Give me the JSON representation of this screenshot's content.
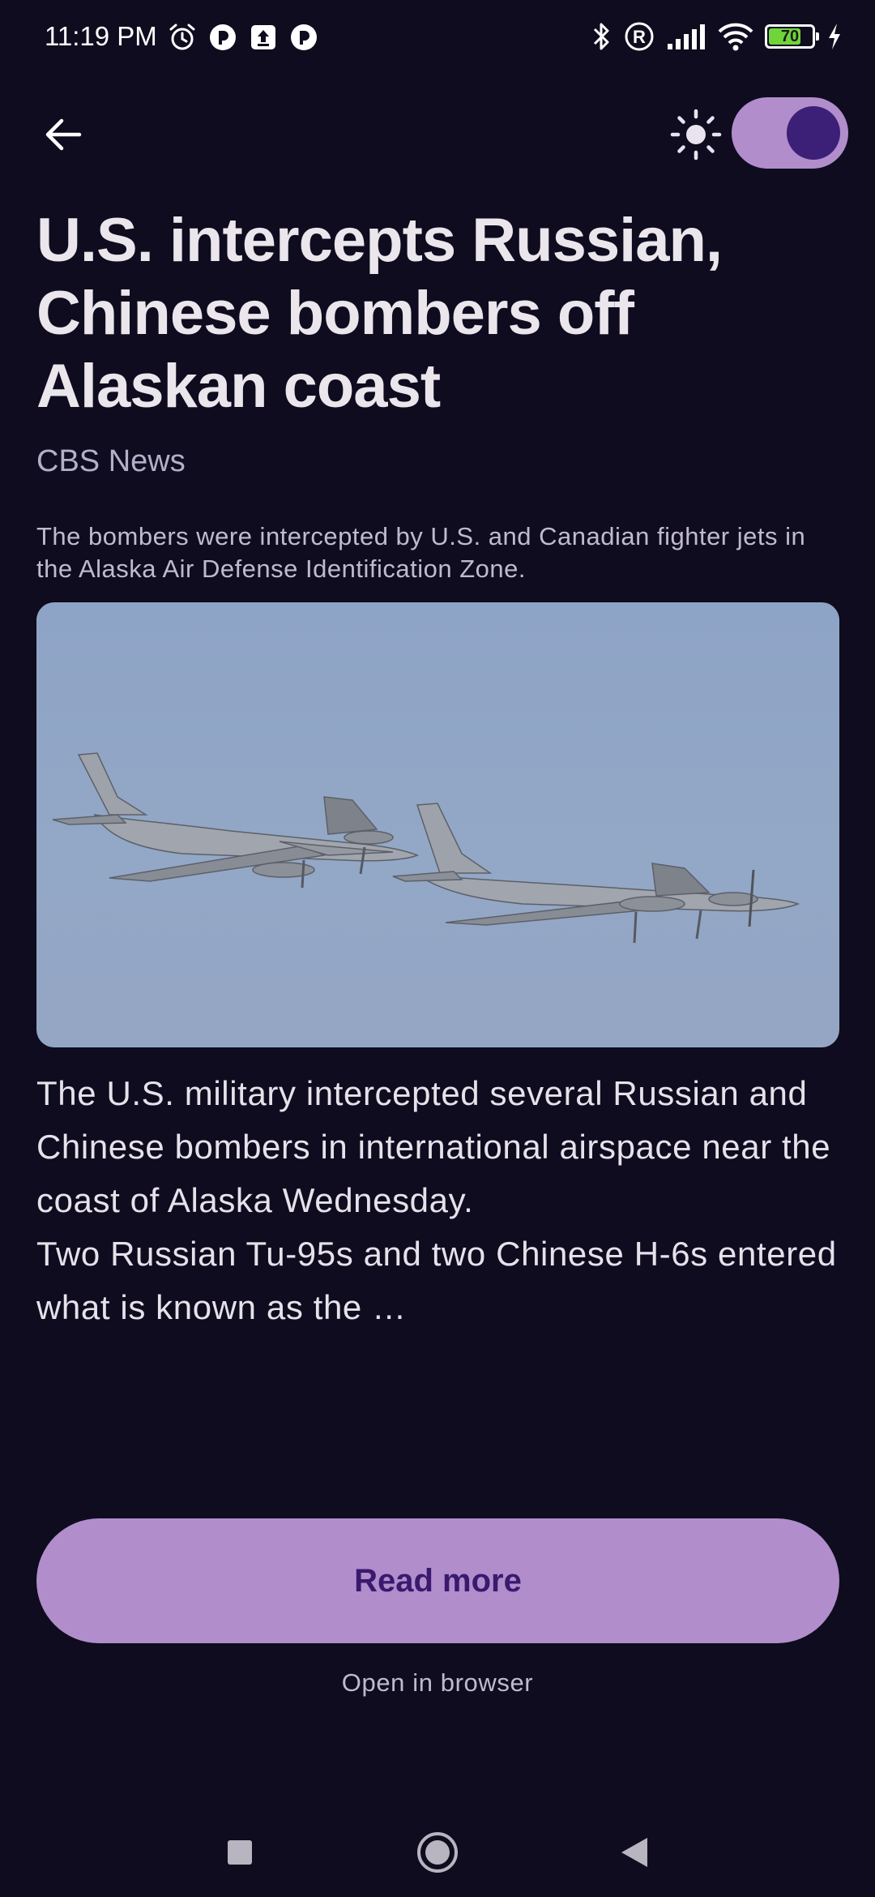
{
  "status_bar": {
    "time": "11:19 PM",
    "battery_level": 70,
    "battery_label": "70",
    "icons": [
      "alarm-icon",
      "app-notification-icon",
      "upload-icon",
      "app-notification-icon",
      "bluetooth-icon",
      "registered-icon",
      "signal-icon",
      "wifi-icon",
      "battery-icon",
      "charging-icon"
    ]
  },
  "toolbar": {
    "back_icon": "arrow-back-icon",
    "theme_icon": "sun-icon",
    "dark_mode_on": true
  },
  "article": {
    "title": "U.S. intercepts Russian, Chinese bombers off Alaskan coast",
    "source": "CBS News",
    "description": "The bombers were intercepted by U.S. and Canadian fighter jets in the Alaska Air Defense Identification Zone.",
    "image_subject": "two-bombers-in-flight",
    "body_line_1": "The U.S. military intercepted several Russian and Chinese bombers in international airspace near the coast of Alaska Wednesday.",
    "body_line_2": "Two Russian Tu-95s and two Chinese H-6s entered what is known as the …"
  },
  "actions": {
    "read_more_label": "Read more",
    "open_browser_label": "Open in browser"
  },
  "nav_bar": {
    "recents_icon": "square-icon",
    "home_icon": "circle-icon",
    "back_icon": "triangle-back-icon"
  },
  "colors": {
    "background": "#0e0c1e",
    "accent": "#b18dcb",
    "accent_on": "#3a1a6e"
  }
}
